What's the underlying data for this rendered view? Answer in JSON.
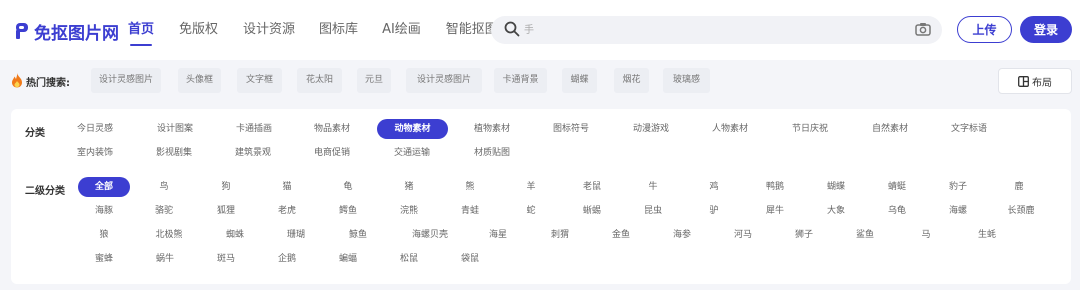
{
  "brand": {
    "name": "免抠图片网",
    "accent": "#3c3ed1"
  },
  "nav": {
    "items": [
      {
        "label": "首页",
        "active": true
      },
      {
        "label": "免版权",
        "active": false
      },
      {
        "label": "设计资源",
        "active": false
      },
      {
        "label": "图标库",
        "active": false
      },
      {
        "label": "AI绘画",
        "active": false
      },
      {
        "label": "智能抠图",
        "active": false
      }
    ]
  },
  "search": {
    "placeholder": "手",
    "icon": "search-icon",
    "image_search_icon": "camera-icon"
  },
  "header_buttons": {
    "upload": "上传",
    "login": "登录"
  },
  "hot_search": {
    "label": "热门搜索:",
    "icon": "fire-icon",
    "tags": [
      "设计灵感图片",
      "头像框",
      "文字框",
      "花太阳",
      "元旦",
      "设计灵感图片",
      "卡通背景",
      "蝴蝶",
      "烟花",
      "玻璃感"
    ]
  },
  "layout_button": {
    "label": "布局",
    "icon": "layout-icon"
  },
  "categories": {
    "label": "分类",
    "selected": "动物素材",
    "rows": [
      [
        "今日灵感",
        "设计图案",
        "卡通插画",
        "物品素材",
        "动物素材",
        "植物素材",
        "图标符号",
        "动漫游戏",
        "人物素材",
        "节日庆祝",
        "自然素材",
        "文字标语"
      ],
      [
        "室内装饰",
        "影视剧集",
        "建筑景观",
        "电商促销",
        "交通运输",
        "材质贴图"
      ]
    ]
  },
  "subcategories": {
    "label": "二级分类",
    "selected": "全部",
    "rows": [
      [
        "全部",
        "鸟",
        "狗",
        "猫",
        "龟",
        "猪",
        "熊",
        "羊",
        "老鼠",
        "牛",
        "鸡",
        "鸭鹅",
        "蝴蝶",
        "蜻蜓",
        "豹子",
        "鹿"
      ],
      [
        "海豚",
        "骆驼",
        "狐狸",
        "老虎",
        "鳄鱼",
        "浣熊",
        "青蛙",
        "蛇",
        "蜥蜴",
        "昆虫",
        "驴",
        "犀牛",
        "大象",
        "乌龟",
        "海螺",
        "长颈鹿"
      ],
      [
        "狼",
        "北极熊",
        "蜘蛛",
        "珊瑚",
        "鲸鱼",
        "海螺贝壳",
        "海星",
        "刺猬",
        "金鱼",
        "海参",
        "河马",
        "狮子",
        "鲨鱼",
        "马",
        "生蚝"
      ],
      [
        "蜜蜂",
        "蜗牛",
        "斑马",
        "企鹅",
        "蝙蝠",
        "松鼠",
        "袋鼠"
      ]
    ]
  }
}
